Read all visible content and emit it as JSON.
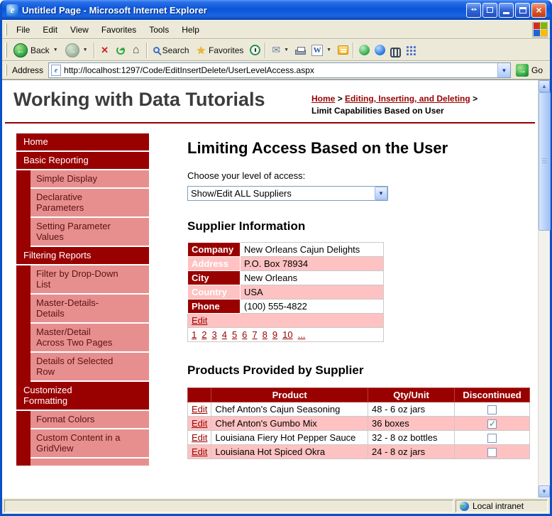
{
  "window": {
    "title": "Untitled Page - Microsoft Internet Explorer",
    "status": "Local intranet",
    "ie_glyph": "e"
  },
  "menu": {
    "items": [
      "File",
      "Edit",
      "View",
      "Favorites",
      "Tools",
      "Help"
    ]
  },
  "toolbar": {
    "back": "Back",
    "search": "Search",
    "favorites": "Favorites",
    "edit_letter": "W"
  },
  "address": {
    "label": "Address",
    "url": "http://localhost:1297/Code/EditInsertDelete/UserLevelAccess.aspx",
    "go": "Go"
  },
  "masthead": {
    "title": "Working with Data Tutorials",
    "crumb_home": "Home",
    "crumb_sep1": ">",
    "crumb_section": "Editing, Inserting, and Deleting",
    "crumb_sep2": ">",
    "crumb_current": "Limit Capabilities Based on User"
  },
  "sidebar": {
    "items": [
      {
        "label": "Home",
        "type": "header"
      },
      {
        "label": "Basic Reporting",
        "type": "header"
      },
      {
        "label": "Simple Display",
        "type": "sub"
      },
      {
        "label": "Declarative Parameters",
        "type": "sub"
      },
      {
        "label": "Setting Parameter Values",
        "type": "sub"
      },
      {
        "label": "Filtering Reports",
        "type": "header"
      },
      {
        "label": "Filter by Drop-Down List",
        "type": "sub"
      },
      {
        "label": "Master-Details-Details",
        "type": "sub"
      },
      {
        "label": "Master/Detail Across Two Pages",
        "type": "sub"
      },
      {
        "label": "Details of Selected Row",
        "type": "sub"
      },
      {
        "label": "Customized Formatting",
        "type": "header"
      },
      {
        "label": "Format Colors",
        "type": "sub"
      },
      {
        "label": "Custom Content in a GridView",
        "type": "sub"
      }
    ]
  },
  "main": {
    "heading": "Limiting Access Based on the User",
    "access_label": "Choose your level of access:",
    "access_value": "Show/Edit ALL Suppliers",
    "supplier_heading": "Supplier Information",
    "supplier_fields": [
      {
        "label": "Company",
        "value": "New Orleans Cajun Delights"
      },
      {
        "label": "Address",
        "value": "P.O. Box 78934"
      },
      {
        "label": "City",
        "value": "New Orleans"
      },
      {
        "label": "Country",
        "value": "USA"
      },
      {
        "label": "Phone",
        "value": "(100) 555-4822"
      }
    ],
    "supplier_edit": "Edit",
    "pager": [
      "1",
      "2",
      "3",
      "4",
      "5",
      "6",
      "7",
      "8",
      "9",
      "10",
      "..."
    ],
    "products_heading": "Products Provided by Supplier",
    "products": {
      "col_product": "Product",
      "col_qty": "Qty/Unit",
      "col_disc": "Discontinued",
      "edit": "Edit",
      "rows": [
        {
          "product": "Chef Anton's Cajun Seasoning",
          "qty": "48 - 6 oz jars",
          "discontinued": false
        },
        {
          "product": "Chef Anton's Gumbo Mix",
          "qty": "36 boxes",
          "discontinued": true
        },
        {
          "product": "Louisiana Fiery Hot Pepper Sauce",
          "qty": "32 - 8 oz bottles",
          "discontinued": false
        },
        {
          "product": "Louisiana Hot Spiced Okra",
          "qty": "24 - 8 oz jars",
          "discontinued": false
        }
      ]
    }
  },
  "icons": {
    "back": "green-circle-left-arrow",
    "forward": "gray-circle-right-arrow",
    "stop": "red-x",
    "refresh": "green-circular-arrow",
    "home": "house",
    "search": "magnifier",
    "favorites": "yellow-star",
    "go": "green-right-arrow",
    "status": "globe"
  },
  "colors": {
    "maroon": "#990000",
    "sidebar_pink": "#e78f8f",
    "row_pink": "#ffc2c2",
    "titlebar_blue": "#0a55d6"
  }
}
